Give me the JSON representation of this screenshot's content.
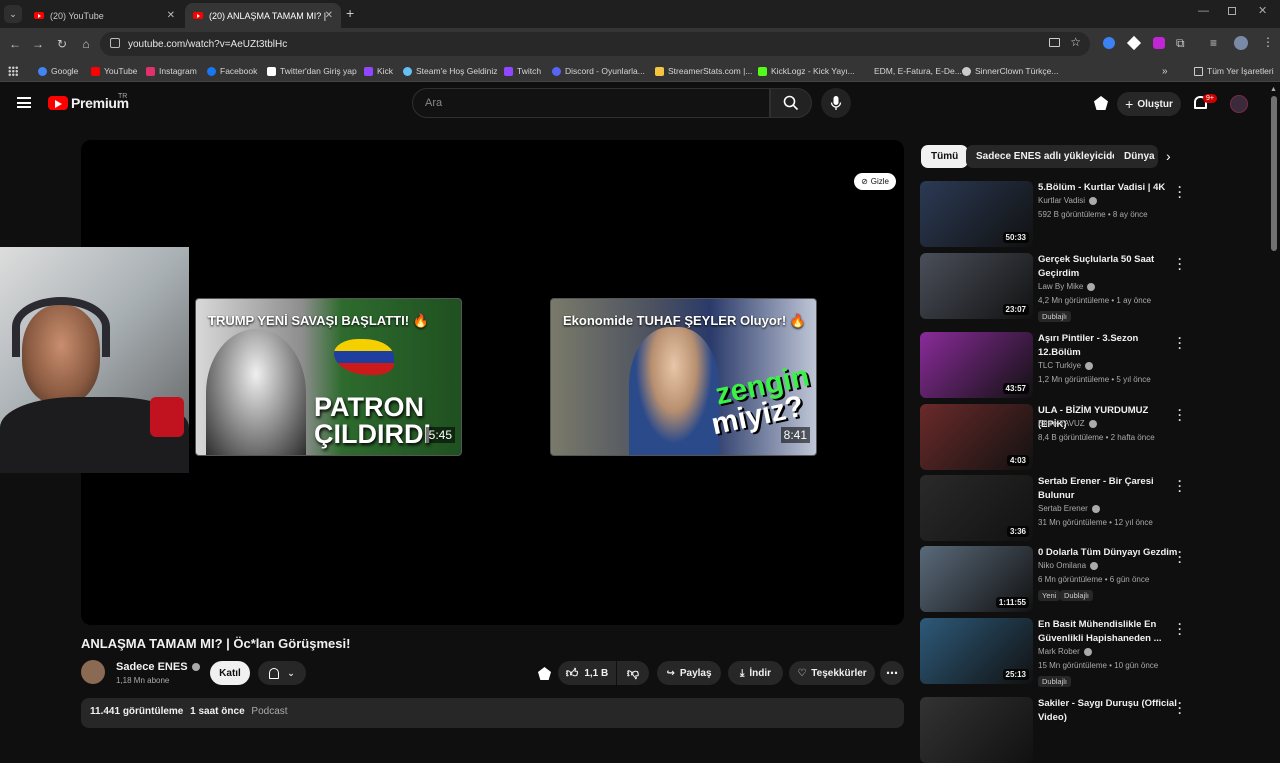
{
  "browser": {
    "tabs": [
      {
        "label": "(20) YouTube"
      },
      {
        "label": "(20) ANLAŞMA TAMAM MI? | Ö"
      }
    ],
    "url": "youtube.com/watch?v=AeUZt3tblHc",
    "bookmarks": [
      {
        "label": "Google",
        "color": "#4285f4"
      },
      {
        "label": "YouTube",
        "color": "#ff0000"
      },
      {
        "label": "Instagram",
        "color": "#e1306c"
      },
      {
        "label": "Facebook",
        "color": "#1877f2"
      },
      {
        "label": "Twitter'dan Giriş yap",
        "color": "#ffffff"
      },
      {
        "label": "Kick",
        "color": "#9146ff"
      },
      {
        "label": "Steam'e Hoş Geldiniz",
        "color": "#66c0f4"
      },
      {
        "label": "Twitch",
        "color": "#9146ff"
      },
      {
        "label": "Discord - Oyunlarla...",
        "color": "#5865f2"
      },
      {
        "label": "StreamerStats.com |...",
        "color": "#f5c542"
      },
      {
        "label": "KickLogz - Kick Yayı...",
        "color": "#53fc18"
      },
      {
        "label": "EDM, E-Fatura, E-De...",
        "color": "#cccccc"
      },
      {
        "label": "SinnerClown Türkçe...",
        "color": "#cccccc"
      }
    ],
    "all_bookmarks": "Tüm Yer İşaretleri"
  },
  "youtube": {
    "logo_text": "Premium",
    "region": "TR",
    "search_placeholder": "Ara",
    "create_label": "Oluştur",
    "notif_count": "9+"
  },
  "player": {
    "hide_label": "Gizle",
    "endcards": [
      {
        "title": "TRUMP YENİ SAVAŞI BAŞLATTI! 🔥",
        "overlay": "PATRON ÇILDIRDI",
        "duration": "5:45"
      },
      {
        "title": "Ekonomide TUHAF ŞEYLER Oluyor! 🔥",
        "overlay1": "zengin",
        "overlay2": "miyiz?",
        "duration": "8:41"
      }
    ]
  },
  "video": {
    "title": "ANLAŞMA TAMAM MI? | Öc*lan Görüşmesi!",
    "channel": "Sadece ENES",
    "subscribers": "1,18 Mn abone",
    "join_label": "Katıl",
    "likes": "1,1 B",
    "share_label": "Paylaş",
    "download_label": "İndir",
    "thanks_label": "Teşekkürler",
    "views": "11.441 görüntüleme",
    "ago": "1 saat önce",
    "tag": "Podcast"
  },
  "sidebar": {
    "chips": [
      "Tümü",
      "Sadece ENES adlı yükleyiciden",
      "Dünya"
    ],
    "recs": [
      {
        "title": "5.Bölüm - Kurtlar Vadisi | 4K",
        "channel": "Kurtlar Vadisi",
        "meta": "592 B görüntüleme • 8 ay önce",
        "duration": "50:33",
        "color": "#2b3a55"
      },
      {
        "title": "Gerçek Suçlularla 50 Saat Geçirdim",
        "channel": "Law By Mike",
        "meta": "4,2 Mn görüntüleme • 1 ay önce",
        "badge": "Dublajlı",
        "duration": "23:07",
        "color": "#4a4f5a"
      },
      {
        "title": "Aşırı Pintiler - 3.Sezon 12.Bölüm",
        "channel": "TLC Turkiye",
        "meta": "1,2 Mn görüntüleme • 5 yıl önce",
        "duration": "43:57",
        "color": "#8a2b9a"
      },
      {
        "title": "ULA - BİZİM YURDUMUZ (EPİK)",
        "channel": "Emre YAVUZ",
        "meta": "8,4 B görüntüleme • 2 hafta önce",
        "duration": "4:03",
        "color": "#6b2a2a"
      },
      {
        "title": "Sertab Erener - Bir Çaresi Bulunur",
        "channel": "Sertab Erener",
        "meta": "31 Mn görüntüleme • 12 yıl önce",
        "duration": "3:36",
        "color": "#2a2a2a"
      },
      {
        "title": "0 Dolarla Tüm Dünyayı Gezdim",
        "channel": "Niko Omilana",
        "meta": "6 Mn görüntüleme • 6 gün önce",
        "badge": "Yeni",
        "badge2": "Dublajlı",
        "duration": "1:11:55",
        "color": "#5a6a7a"
      },
      {
        "title": "En Basit Mühendislikle En Güvenlikli Hapishaneden ...",
        "channel": "Mark Rober",
        "meta": "15 Mn görüntüleme • 10 gün önce",
        "badge": "Dublajlı",
        "duration": "25:13",
        "color": "#2d5a7a"
      },
      {
        "title": "Sakiler - Saygı Duruşu (Official Video)",
        "channel": "",
        "meta": "",
        "duration": "",
        "color": "#333333"
      }
    ]
  }
}
